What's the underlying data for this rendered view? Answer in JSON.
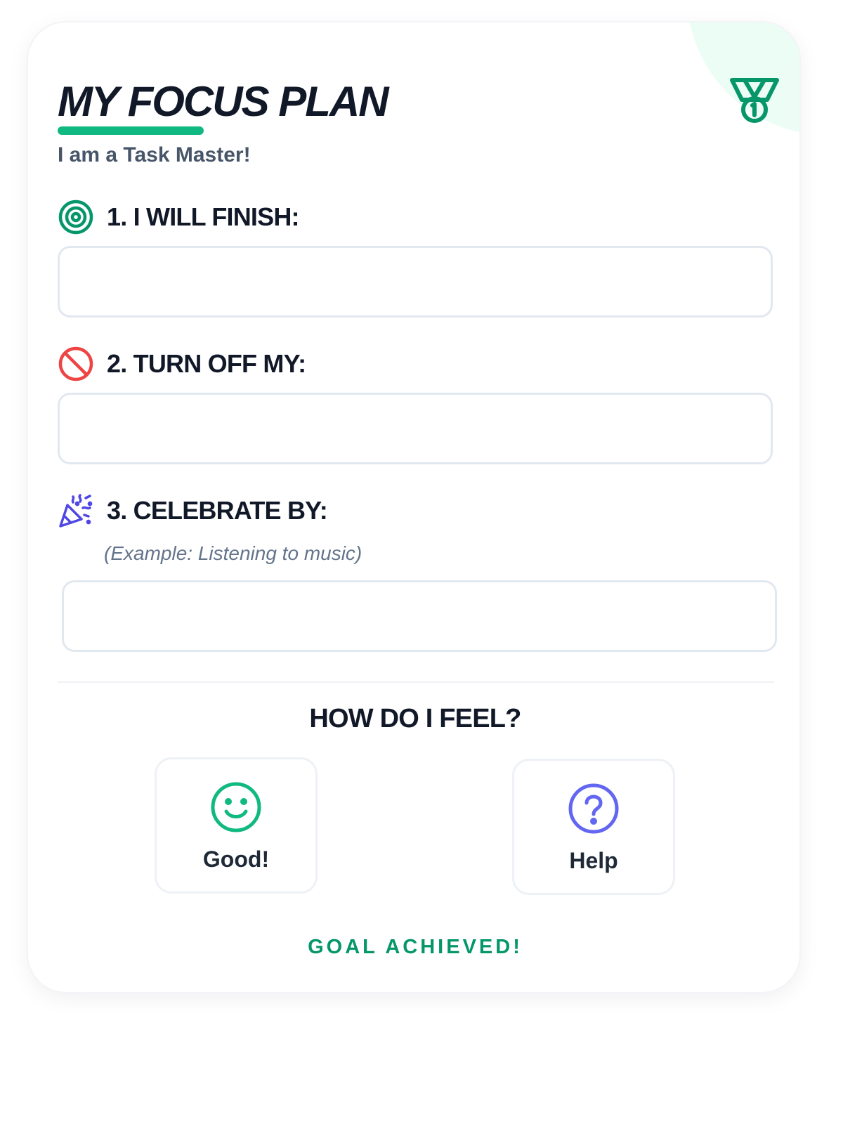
{
  "header": {
    "title": "MY FOCUS PLAN",
    "subtitle": "I am a Task Master!",
    "badge_icon": "medal-icon"
  },
  "sections": [
    {
      "label": "1. I WILL FINISH:",
      "icon": "target-icon",
      "color": "#059669",
      "value": ""
    },
    {
      "label": "2. TURN OFF MY:",
      "icon": "prohibited-icon",
      "color": "#ef4444",
      "value": ""
    },
    {
      "label": "3. CELEBRATE BY:",
      "icon": "party-popper-icon",
      "color": "#4f46e5",
      "hint": "(Example: Listening to music)",
      "value": ""
    }
  ],
  "feelings": {
    "title": "HOW DO I FEEL?",
    "options": [
      {
        "label": "Good!",
        "icon": "smile-icon",
        "color": "#10b981"
      },
      {
        "label": "Help",
        "icon": "question-circle-icon",
        "color": "#6366f1"
      }
    ]
  },
  "footer": {
    "status": "GOAL ACHIEVED!"
  },
  "colors": {
    "accent": "#10b981",
    "accent_dark": "#059669",
    "text": "#111827",
    "muted": "#475569",
    "border": "#e2e8f0"
  }
}
